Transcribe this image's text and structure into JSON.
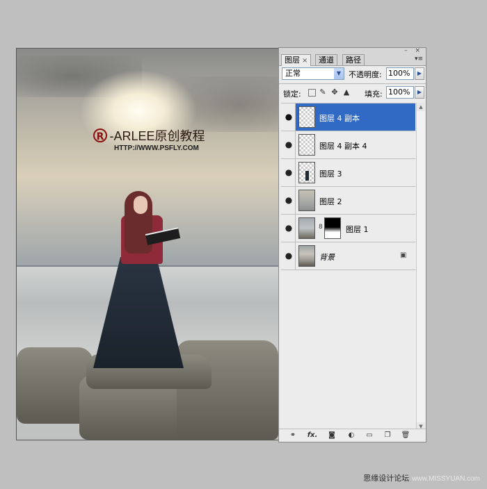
{
  "canvas": {
    "watermark_title": "-ARLEE原创教程",
    "watermark_url": "HTTP://WWW.PSFLY.COM",
    "logo_glyph": "R"
  },
  "panel": {
    "tabs": [
      {
        "label": "图层",
        "close": "×",
        "active": true
      },
      {
        "label": "通道",
        "active": false
      },
      {
        "label": "路径",
        "active": false
      }
    ],
    "window_controls": "– ×",
    "menu_glyph": "▾≡",
    "blend_mode": "正常",
    "opacity_label": "不透明度:",
    "opacity_value": "100%",
    "lock_label": "锁定:",
    "fill_label": "填充:",
    "fill_value": "100%",
    "layers": [
      {
        "name": "图层 4 副本",
        "thumb": "checker",
        "selected": true
      },
      {
        "name": "图层 4 副本 4",
        "thumb": "checker",
        "selected": false
      },
      {
        "name": "图层 3",
        "thumb": "girl",
        "selected": false
      },
      {
        "name": "图层 2",
        "thumb": "sky",
        "selected": false
      },
      {
        "name": "图层 1",
        "thumb": "rocks",
        "mask": true,
        "selected": false
      },
      {
        "name": "背景",
        "thumb": "bg",
        "locked": true,
        "italic": true,
        "selected": false
      }
    ],
    "bottom_icons": [
      "link-icon",
      "fx-icon",
      "mask-icon",
      "adjustment-icon",
      "folder-icon",
      "new-layer-icon",
      "trash-icon"
    ]
  },
  "footer": {
    "text": "思缘设计论坛",
    "site": "www.MISSYUAN.com"
  }
}
